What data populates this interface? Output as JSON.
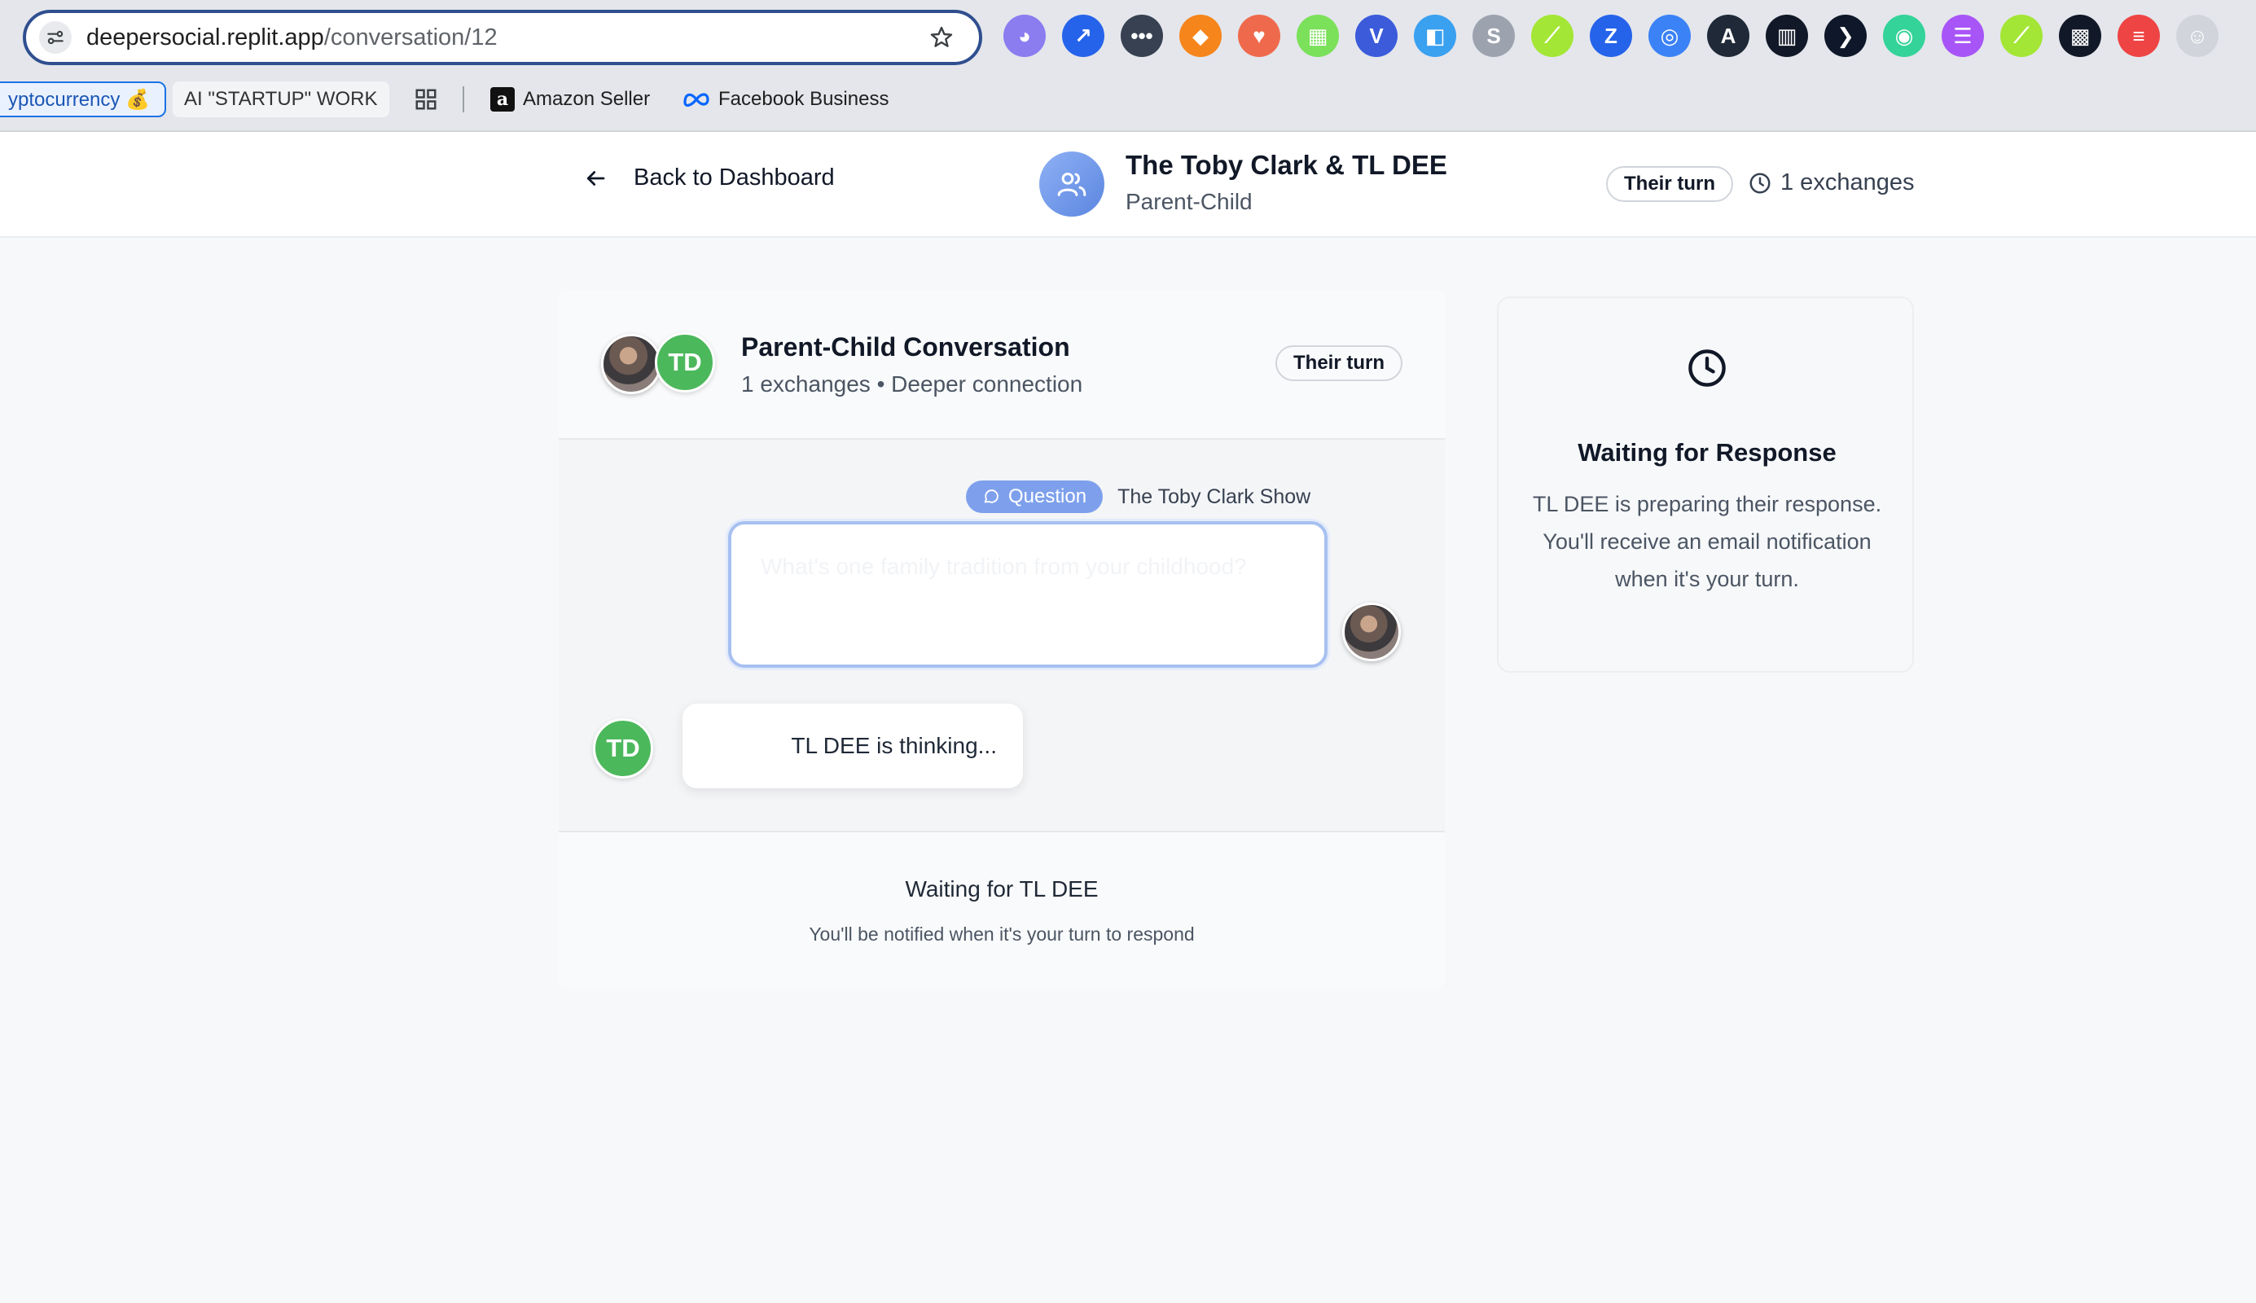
{
  "browser": {
    "url_host": "deepersocial.replit.app",
    "url_path": "/conversation/12",
    "extensions": [
      {
        "icon": "ghost-ext-icon",
        "color": "#8b7cf0",
        "glyph": "◕"
      },
      {
        "icon": "cursor-ext-icon",
        "color": "#2563eb",
        "glyph": "↗"
      },
      {
        "icon": "dots-ext-icon",
        "color": "#374151",
        "glyph": "•••"
      },
      {
        "icon": "fox-ext-icon",
        "color": "#f6851b",
        "glyph": "◆"
      },
      {
        "icon": "heart-ext-icon",
        "color": "#ef6a4c",
        "glyph": "♥"
      },
      {
        "icon": "pixel-ext-icon",
        "color": "#7be05a",
        "glyph": "▦"
      },
      {
        "icon": "v-ext-icon",
        "color": "#3b5bdb",
        "glyph": "V"
      },
      {
        "icon": "square-ext-icon",
        "color": "#3aa0f0",
        "glyph": "◧"
      },
      {
        "icon": "s-ext-icon",
        "color": "#9ca3af",
        "glyph": "S"
      },
      {
        "icon": "chart-ext-icon",
        "color": "#a3e635",
        "glyph": "⟋"
      },
      {
        "icon": "z-ext-icon",
        "color": "#2563eb",
        "glyph": "Z"
      },
      {
        "icon": "globe-ext-icon",
        "color": "#3b82f6",
        "glyph": "◎"
      },
      {
        "icon": "a-ext-icon",
        "color": "#1f2937",
        "glyph": "A"
      },
      {
        "icon": "stripes-ext-icon",
        "color": "#111827",
        "glyph": "▥"
      },
      {
        "icon": "play-ext-icon",
        "color": "#0f172a",
        "glyph": "❯"
      },
      {
        "icon": "frog-ext-icon",
        "color": "#34d399",
        "glyph": "◉"
      },
      {
        "icon": "list-ext-icon",
        "color": "#a855f7",
        "glyph": "☰"
      },
      {
        "icon": "chart2-ext-icon",
        "color": "#a3e635",
        "glyph": "⟋"
      },
      {
        "icon": "grid-ext-icon",
        "color": "#111827",
        "glyph": "▩"
      },
      {
        "icon": "bars-ext-icon",
        "color": "#ef4444",
        "glyph": "≡"
      },
      {
        "icon": "face-ext-icon",
        "color": "#d1d5db",
        "glyph": "☺"
      }
    ],
    "bookmarks": {
      "crypto": "yptocurrency 💰",
      "startup": "AI \"STARTUP\" WORK",
      "amazon": "Amazon Seller",
      "facebook": "Facebook Business"
    }
  },
  "header": {
    "back_label": "Back to Dashboard",
    "title": "The Toby Clark & TL DEE",
    "subtitle": "Parent-Child",
    "turn_status": "Their turn",
    "exchanges": "1 exchanges"
  },
  "conversation": {
    "title": "Parent-Child Conversation",
    "meta": "1 exchanges • Deeper connection",
    "turn_status": "Their turn",
    "participant_initials": "TD",
    "question_badge": "Question",
    "question_author": "The Toby Clark Show",
    "question_text": "What's one family tradition from your childhood?",
    "thinking_text": "TL DEE is thinking...",
    "footer_title": "Waiting for TL DEE",
    "footer_subtitle": "You'll be notified when it's your turn to respond"
  },
  "sidebar": {
    "title": "Waiting for Response",
    "text": "TL DEE is preparing their response. You'll receive an email notification when it's your turn."
  }
}
